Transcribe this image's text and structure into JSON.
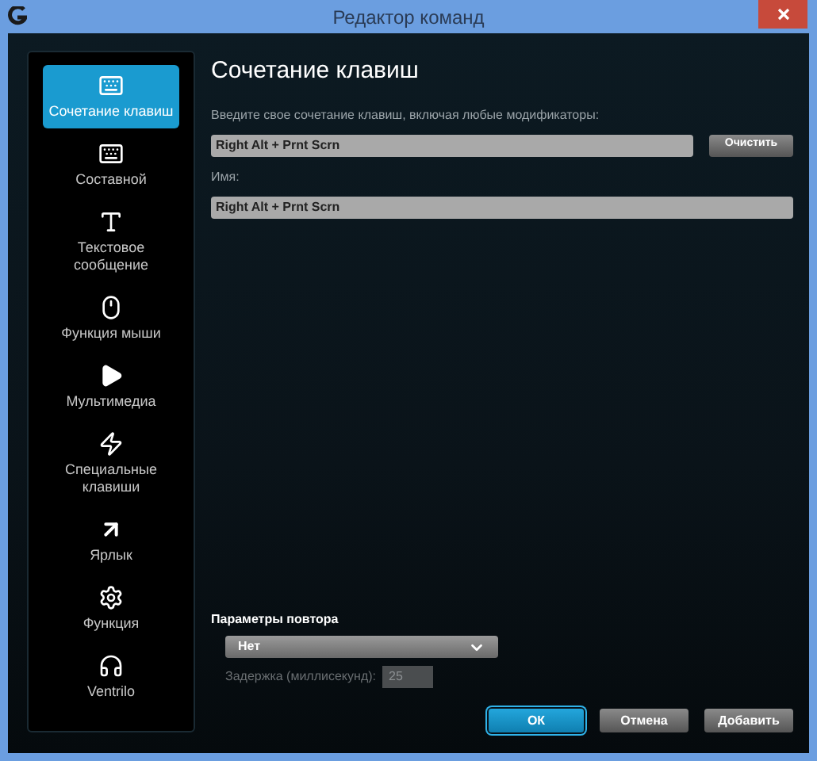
{
  "window": {
    "title": "Редактор команд"
  },
  "sidebar": {
    "items": [
      {
        "kind": "keys",
        "label": "Сочетание клавиш",
        "selected": true
      },
      {
        "kind": "multikey",
        "label": "Составной",
        "selected": false
      },
      {
        "kind": "text",
        "label": "Текстовое сообщение",
        "selected": false
      },
      {
        "kind": "mouse",
        "label": "Функция мыши",
        "selected": false
      },
      {
        "kind": "media",
        "label": "Мультимедиа",
        "selected": false
      },
      {
        "kind": "special",
        "label": "Специальные клавиши",
        "selected": false
      },
      {
        "kind": "shortcut",
        "label": "Ярлык",
        "selected": false
      },
      {
        "kind": "function",
        "label": "Функция",
        "selected": false
      },
      {
        "kind": "headset",
        "label": "Ventrilo",
        "selected": false
      }
    ]
  },
  "content": {
    "heading": "Сочетание клавиш",
    "keys_label": "Введите свое сочетание клавиш, включая любые модификаторы:",
    "keys_value": "Right Alt + Prnt Scrn",
    "clear_button": "Очистить",
    "name_label": "Имя:",
    "name_value": "Right Alt + Prnt Scrn"
  },
  "repeat": {
    "heading": "Параметры повтора",
    "option": "Нет",
    "delay_label": "Задержка (миллисекунд):",
    "delay_value": "25",
    "delay_disabled": true
  },
  "buttons": [
    {
      "label": "ОК",
      "selected": true
    },
    {
      "label": "Отмена",
      "selected": false
    },
    {
      "label": "Добавить",
      "selected": false
    }
  ]
}
